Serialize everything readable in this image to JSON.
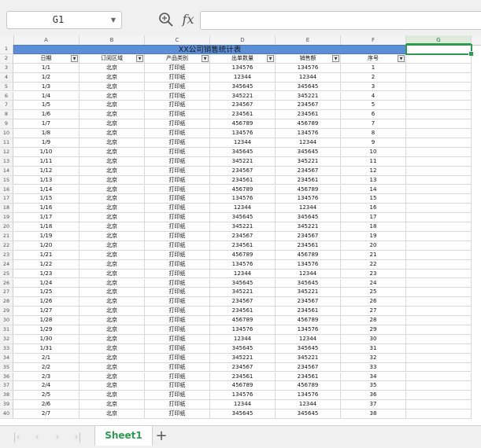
{
  "formula_bar": {
    "name_box": "G1",
    "fx_label": "fx",
    "formula_value": ""
  },
  "columns": [
    "A",
    "B",
    "C",
    "D",
    "E",
    "F",
    "G"
  ],
  "selected_cell": "G1",
  "title": "XX公司销售统计表",
  "headers": [
    "日期",
    "订阅区域",
    "产品类别",
    "出单数量",
    "销售额",
    "序号"
  ],
  "rows": [
    [
      "1/1",
      "北京",
      "打印纸",
      "134576",
      "134576",
      "1"
    ],
    [
      "1/2",
      "北京",
      "打印纸",
      "12344",
      "12344",
      "2"
    ],
    [
      "1/3",
      "北京",
      "打印纸",
      "345645",
      "345645",
      "3"
    ],
    [
      "1/4",
      "北京",
      "打印纸",
      "345221",
      "345221",
      "4"
    ],
    [
      "1/5",
      "北京",
      "打印纸",
      "234567",
      "234567",
      "5"
    ],
    [
      "1/6",
      "北京",
      "打印纸",
      "234561",
      "234561",
      "6"
    ],
    [
      "1/7",
      "北京",
      "打印纸",
      "456789",
      "456789",
      "7"
    ],
    [
      "1/8",
      "北京",
      "打印纸",
      "134576",
      "134576",
      "8"
    ],
    [
      "1/9",
      "北京",
      "打印纸",
      "12344",
      "12344",
      "9"
    ],
    [
      "1/10",
      "北京",
      "打印纸",
      "345645",
      "345645",
      "10"
    ],
    [
      "1/11",
      "北京",
      "打印纸",
      "345221",
      "345221",
      "11"
    ],
    [
      "1/12",
      "北京",
      "打印纸",
      "234567",
      "234567",
      "12"
    ],
    [
      "1/13",
      "北京",
      "打印纸",
      "234561",
      "234561",
      "13"
    ],
    [
      "1/14",
      "北京",
      "打印纸",
      "456789",
      "456789",
      "14"
    ],
    [
      "1/15",
      "北京",
      "打印纸",
      "134576",
      "134576",
      "15"
    ],
    [
      "1/16",
      "北京",
      "打印纸",
      "12344",
      "12344",
      "16"
    ],
    [
      "1/17",
      "北京",
      "打印纸",
      "345645",
      "345645",
      "17"
    ],
    [
      "1/18",
      "北京",
      "打印纸",
      "345221",
      "345221",
      "18"
    ],
    [
      "1/19",
      "北京",
      "打印纸",
      "234567",
      "234567",
      "19"
    ],
    [
      "1/20",
      "北京",
      "打印纸",
      "234561",
      "234561",
      "20"
    ],
    [
      "1/21",
      "北京",
      "打印纸",
      "456789",
      "456789",
      "21"
    ],
    [
      "1/22",
      "北京",
      "打印纸",
      "134576",
      "134576",
      "22"
    ],
    [
      "1/23",
      "北京",
      "打印纸",
      "12344",
      "12344",
      "23"
    ],
    [
      "1/24",
      "北京",
      "打印纸",
      "345645",
      "345645",
      "24"
    ],
    [
      "1/25",
      "北京",
      "打印纸",
      "345221",
      "345221",
      "25"
    ],
    [
      "1/26",
      "北京",
      "打印纸",
      "234567",
      "234567",
      "26"
    ],
    [
      "1/27",
      "北京",
      "打印纸",
      "234561",
      "234561",
      "27"
    ],
    [
      "1/28",
      "北京",
      "打印纸",
      "456789",
      "456789",
      "28"
    ],
    [
      "1/29",
      "北京",
      "打印纸",
      "134576",
      "134576",
      "29"
    ],
    [
      "1/30",
      "北京",
      "打印纸",
      "12344",
      "12344",
      "30"
    ],
    [
      "1/31",
      "北京",
      "打印纸",
      "345645",
      "345645",
      "31"
    ],
    [
      "2/1",
      "北京",
      "打印纸",
      "345221",
      "345221",
      "32"
    ],
    [
      "2/2",
      "北京",
      "打印纸",
      "234567",
      "234567",
      "33"
    ],
    [
      "2/3",
      "北京",
      "打印纸",
      "234561",
      "234561",
      "34"
    ],
    [
      "2/4",
      "北京",
      "打印纸",
      "456789",
      "456789",
      "35"
    ],
    [
      "2/5",
      "北京",
      "打印纸",
      "134576",
      "134576",
      "36"
    ],
    [
      "2/6",
      "北京",
      "打印纸",
      "12344",
      "12344",
      "37"
    ],
    [
      "2/7",
      "北京",
      "打印纸",
      "345645",
      "345645",
      "38"
    ]
  ],
  "sheet_tabs": [
    "Sheet1"
  ],
  "add_sheet_label": "+",
  "colors": {
    "title_fill": "#5b8ed6",
    "selection": "#2e9a4f",
    "active_tab_text": "#2e9a4f"
  }
}
